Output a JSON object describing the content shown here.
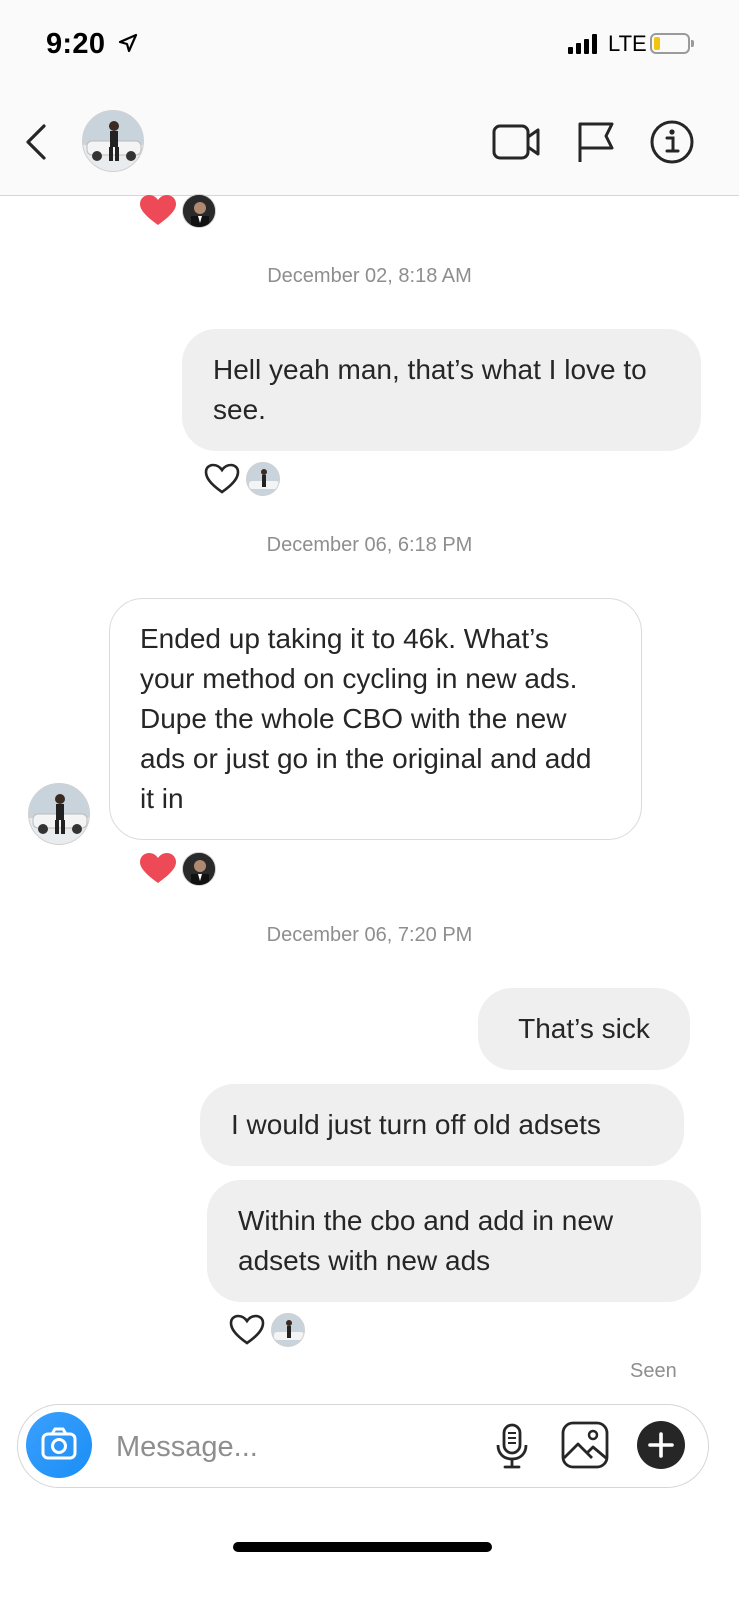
{
  "status_bar": {
    "time": "9:20",
    "network": "LTE"
  },
  "header": {
    "icons": [
      "back-chevron-icon",
      "video-call-icon",
      "flag-icon",
      "info-icon"
    ]
  },
  "messages": [
    {
      "timestamp": "December 02, 8:18 AM",
      "text": "Hell yeah man, that’s what I love to see.",
      "direction": "outgoing"
    },
    {
      "timestamp": "December 06, 6:18 PM",
      "text": "Ended up taking it to 46k. What’s your method on cycling in new ads. Dupe the whole CBO with the new ads or just go in the original and add it in",
      "direction": "incoming"
    },
    {
      "timestamp": "December 06, 7:20 PM",
      "text": "That’s sick",
      "direction": "outgoing"
    },
    {
      "text": "I would just turn off old adsets",
      "direction": "outgoing"
    },
    {
      "text": "Within the cbo and add in new adsets with new ads",
      "direction": "outgoing"
    }
  ],
  "seen_label": "Seen",
  "composer": {
    "placeholder": "Message...",
    "icons": [
      "camera-icon",
      "microphone-icon",
      "gallery-icon",
      "plus-icon"
    ]
  },
  "colors": {
    "heart_liked": "#ed4956",
    "camera_button": "#1b8ef5",
    "outgoing_bubble": "#efefef"
  }
}
